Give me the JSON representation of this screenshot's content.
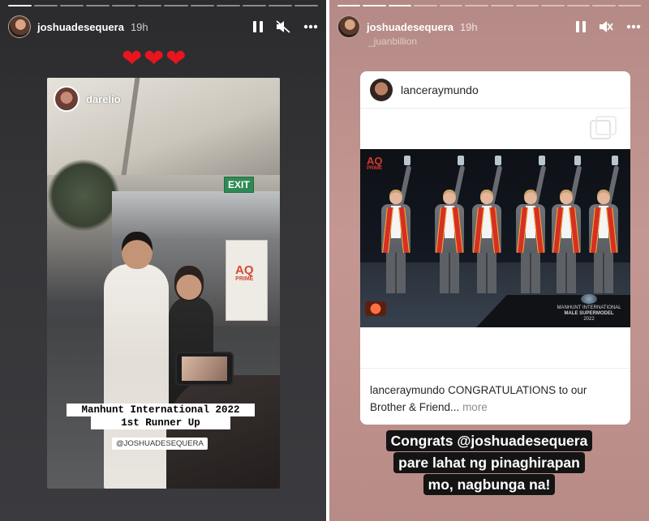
{
  "left_story": {
    "username": "joshuadesequera",
    "time": "19h",
    "progress_segments": [
      1,
      0,
      0,
      0,
      0,
      0,
      0,
      0,
      0,
      0,
      0,
      0
    ],
    "hearts": [
      "❤",
      "❤",
      "❤"
    ],
    "repost": {
      "username": "darelio",
      "exit_sign": "EXIT",
      "banner_brand": "AQ",
      "banner_sub": "PRIME",
      "caption_line1": "Manhunt International 2022",
      "caption_line2": "1st Runner Up",
      "mention": "@JOSHUADESEQUERA"
    }
  },
  "right_story": {
    "username": "joshuadesequera",
    "time": "19h",
    "sub_username": "_juanbillion",
    "progress_segments": [
      1,
      1,
      1,
      0,
      0,
      0,
      0,
      0,
      0,
      0,
      0,
      0
    ],
    "post": {
      "username": "lanceraymundo",
      "photo_brand": "AQ",
      "photo_brand_sub": "PRIME",
      "photo_event_line1": "MANHUNT INTERNATIONAL",
      "photo_event_line2": "MALE SUPERMODEL",
      "photo_event_line3": "2022",
      "caption_user": "lanceraymundo",
      "caption_text": "CONGRATULATIONS to our Brother & Friend...",
      "caption_more": "more"
    },
    "congrats_lines": [
      "Congrats @joshuadesequera",
      "pare lahat ng pinaghirapan",
      "mo, nagbunga na!"
    ]
  },
  "icons": {
    "pause": "pause-icon",
    "mute": "mute-icon",
    "more": "more-icon",
    "heart": "heart-icon"
  },
  "colors": {
    "heart": "#e8151e",
    "exit_green": "#2e8a55",
    "sash_red": "#d62f24",
    "story_right_bg": "#c49792",
    "story_left_bg": "#353538"
  }
}
